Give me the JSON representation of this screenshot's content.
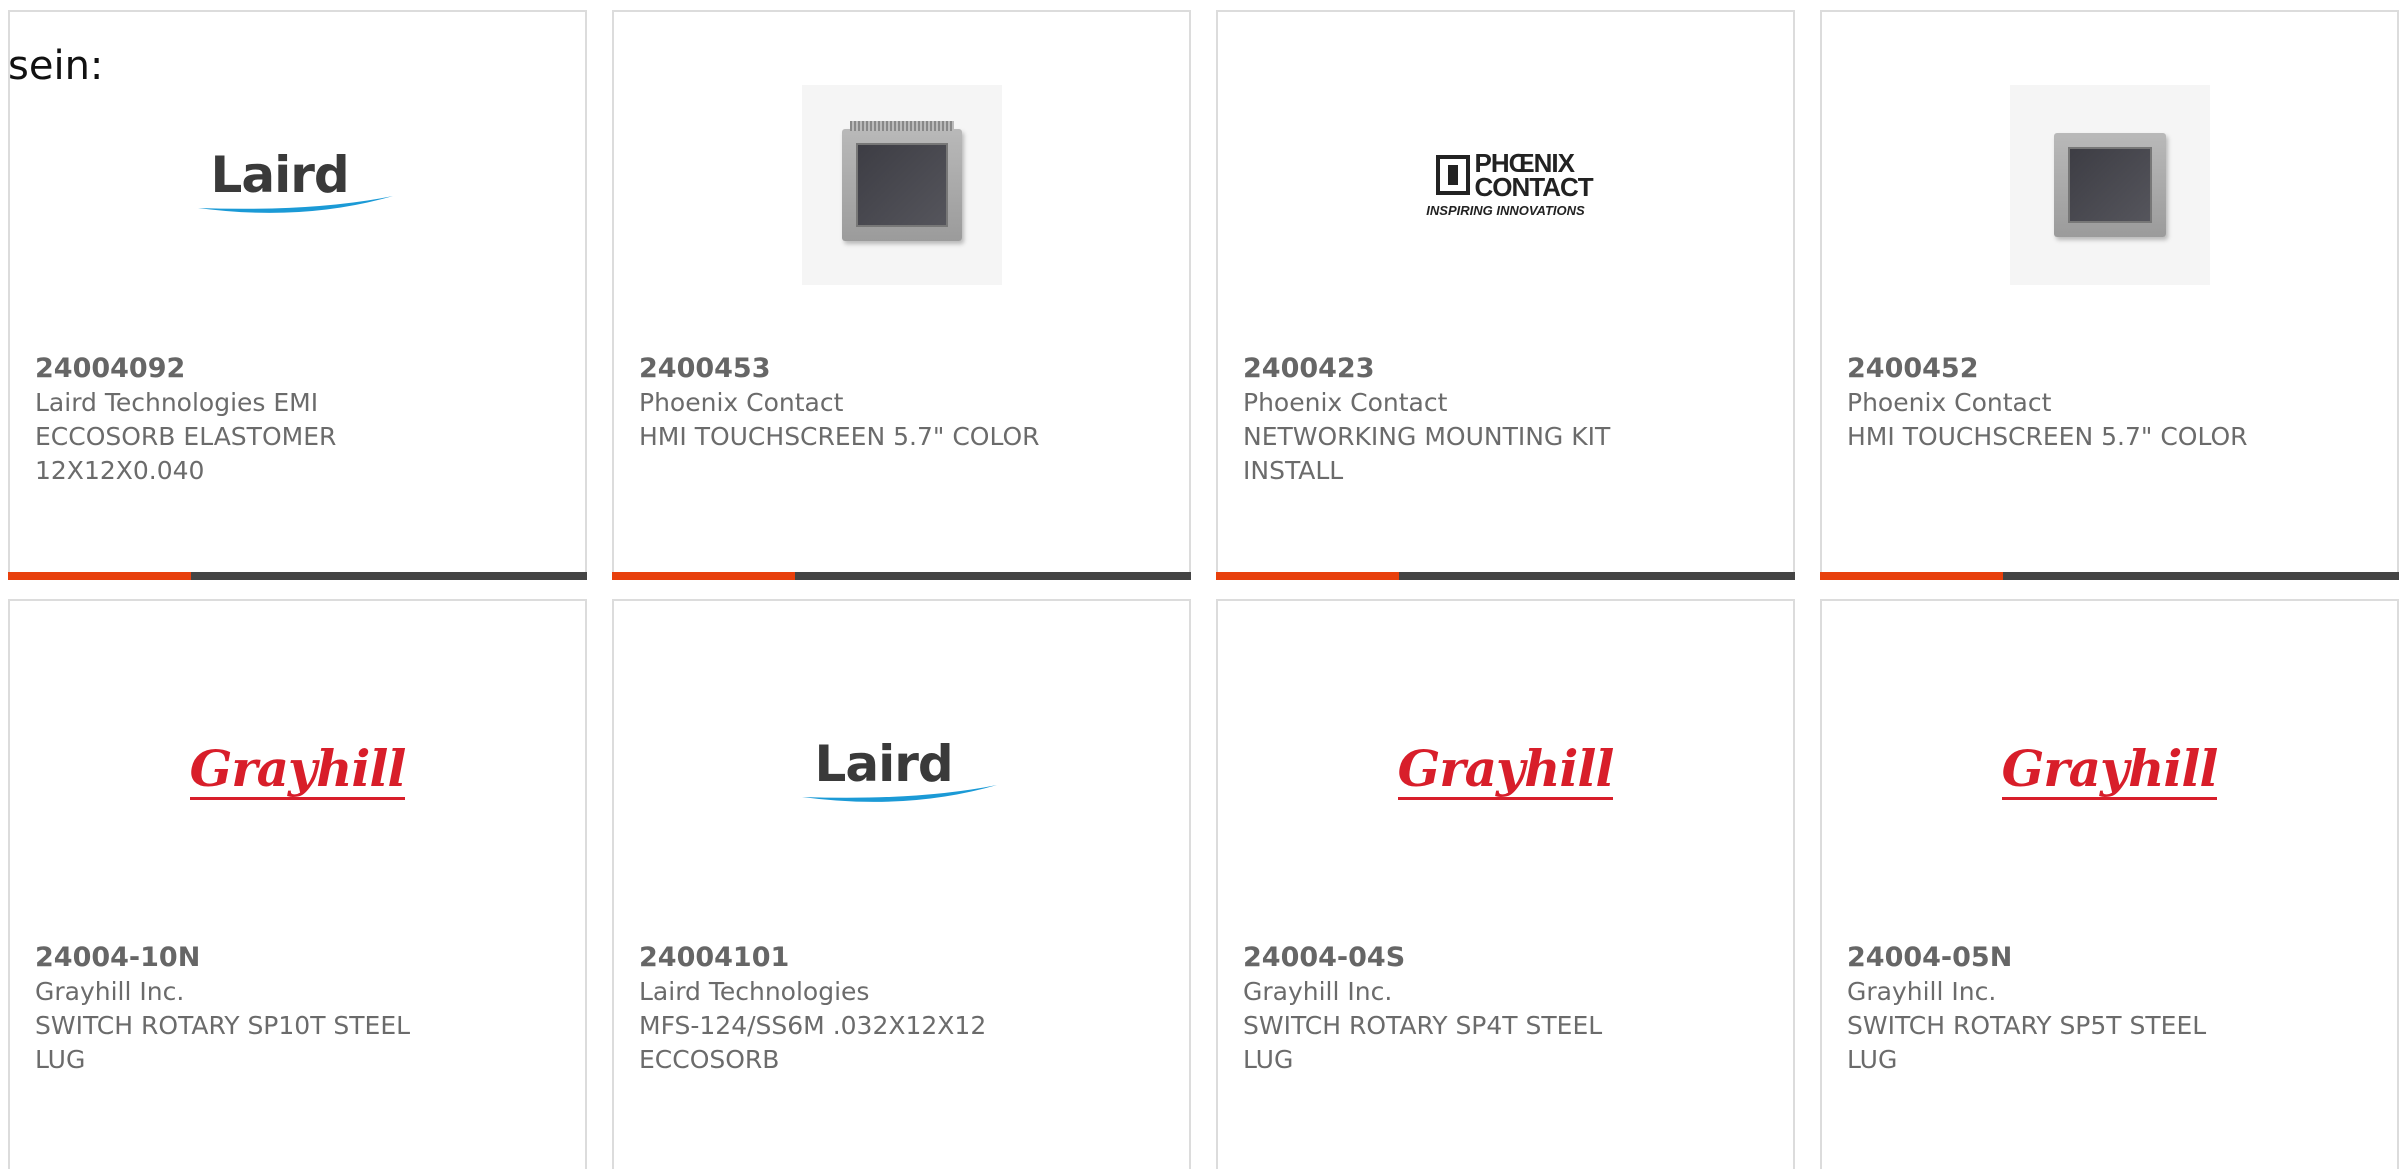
{
  "header_fragment": "sein:",
  "colors": {
    "accent": "#e8400c",
    "bar": "#444444",
    "border": "#dcdcdc"
  },
  "products": [
    {
      "part_number": "24004092",
      "manufacturer": "Laird Technologies EMI",
      "description": "ECCOSORB ELASTOMER 12X12X0.040",
      "logo": "laird-logo",
      "logo_text": "Laird"
    },
    {
      "part_number": "2400453",
      "manufacturer": "Phoenix Contact",
      "description": "HMI TOUCHSCREEN 5.7\" COLOR",
      "logo": "hmi-touchscreen-photo"
    },
    {
      "part_number": "2400423",
      "manufacturer": "Phoenix Contact",
      "description": "NETWORKING MOUNTING KIT INSTALL",
      "logo": "phoenix-contact-logo",
      "logo_text": "PHŒNIX CONTACT",
      "logo_tagline": "INSPIRING INNOVATIONS"
    },
    {
      "part_number": "2400452",
      "manufacturer": "Phoenix Contact",
      "description": "HMI TOUCHSCREEN 5.7\" COLOR",
      "logo": "hmi-touchscreen-photo"
    },
    {
      "part_number": "24004-10N",
      "manufacturer": "Grayhill Inc.",
      "description": "SWITCH ROTARY SP10T STEEL LUG",
      "logo": "grayhill-logo",
      "logo_text": "Grayhill"
    },
    {
      "part_number": "24004101",
      "manufacturer": "Laird Technologies",
      "description": "MFS-124/SS6M .032X12X12 ECCOSORB",
      "logo": "laird-logo",
      "logo_text": "Laird"
    },
    {
      "part_number": "24004-04S",
      "manufacturer": "Grayhill Inc.",
      "description": "SWITCH ROTARY SP4T STEEL LUG",
      "logo": "grayhill-logo",
      "logo_text": "Grayhill"
    },
    {
      "part_number": "24004-05N",
      "manufacturer": "Grayhill Inc.",
      "description": "SWITCH ROTARY SP5T STEEL LUG",
      "logo": "grayhill-logo",
      "logo_text": "Grayhill"
    }
  ]
}
